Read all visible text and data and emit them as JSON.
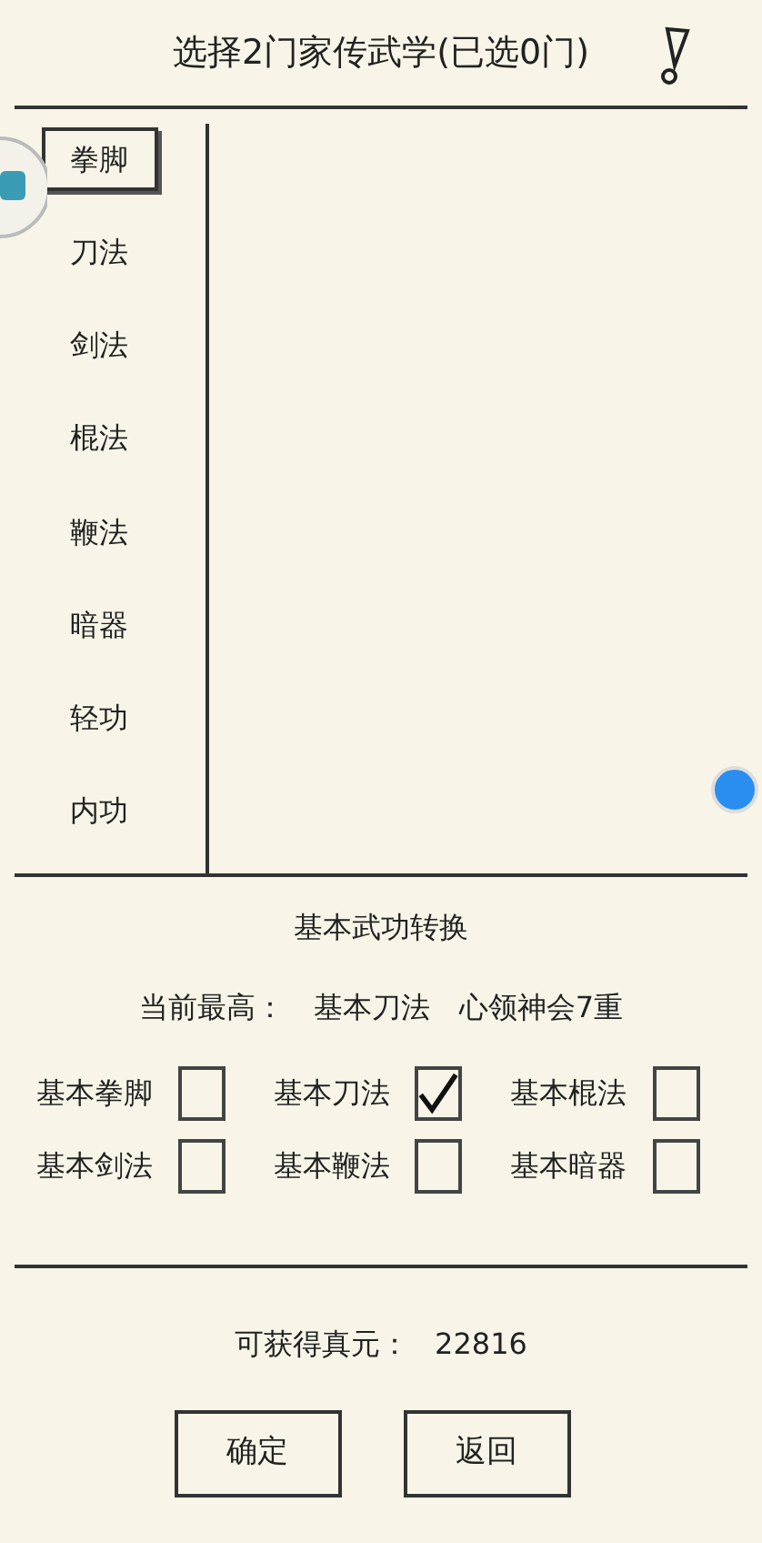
{
  "title": "选择2门家传武学(已选0门)",
  "categories": [
    {
      "label": "拳脚",
      "selected": true
    },
    {
      "label": "刀法",
      "selected": false
    },
    {
      "label": "剑法",
      "selected": false
    },
    {
      "label": "棍法",
      "selected": false
    },
    {
      "label": "鞭法",
      "selected": false
    },
    {
      "label": "暗器",
      "selected": false
    },
    {
      "label": "轻功",
      "selected": false
    },
    {
      "label": "内功",
      "selected": false
    }
  ],
  "conversion": {
    "title": "基本武功转换",
    "highest_label": "当前最高：",
    "highest_skill": "基本刀法",
    "highest_level": "心领神会7重",
    "options": [
      {
        "label": "基本拳脚",
        "checked": false
      },
      {
        "label": "基本刀法",
        "checked": true
      },
      {
        "label": "基本棍法",
        "checked": false
      },
      {
        "label": "基本剑法",
        "checked": false
      },
      {
        "label": "基本鞭法",
        "checked": false
      },
      {
        "label": "基本暗器",
        "checked": false
      }
    ]
  },
  "reward": {
    "label": "可获得真元：",
    "value": "22816"
  },
  "buttons": [
    "确定",
    "返回"
  ]
}
